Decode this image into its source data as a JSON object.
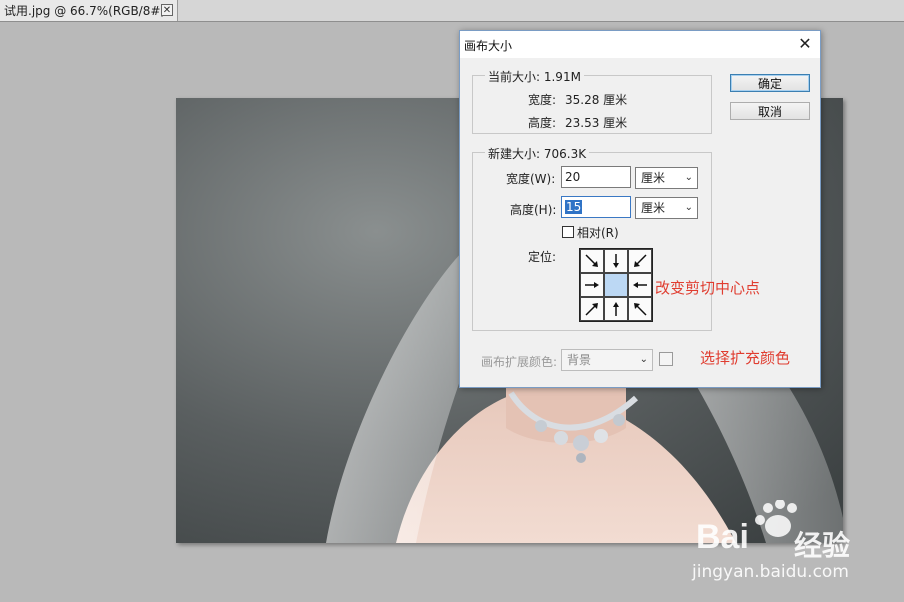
{
  "document_tab": {
    "title": "试用.jpg @ 66.7%(RGB/8#)",
    "close_symbol": "✕"
  },
  "dialog": {
    "title": "画布大小",
    "close_symbol": "✕",
    "ok_label": "确定",
    "cancel_label": "取消",
    "current_size": {
      "label": "当前大小: 1.91M",
      "width_label": "宽度:",
      "width_value": "35.28 厘米",
      "height_label": "高度:",
      "height_value": "23.53 厘米"
    },
    "new_size": {
      "label": "新建大小: 706.3K",
      "width_label": "宽度(W):",
      "width_value": "20",
      "width_unit": "厘米",
      "height_label": "高度(H):",
      "height_value": "15",
      "height_unit": "厘米",
      "relative_label": "相对(R)",
      "relative_checked": false,
      "anchor_label": "定位:"
    },
    "extension_color": {
      "label": "画布扩展颜色:",
      "value": "背景"
    }
  },
  "annotations": {
    "anchor_note": "改变剪切中心点",
    "color_note": "选择扩充颜色"
  },
  "watermark": {
    "brand": "Bai",
    "brand_suffix": "经验",
    "url": "jingyan.baidu.com"
  },
  "colors": {
    "annotation": "#e03d30",
    "focus": "#3a78c4",
    "anchor_center": "#bcd8f4"
  }
}
